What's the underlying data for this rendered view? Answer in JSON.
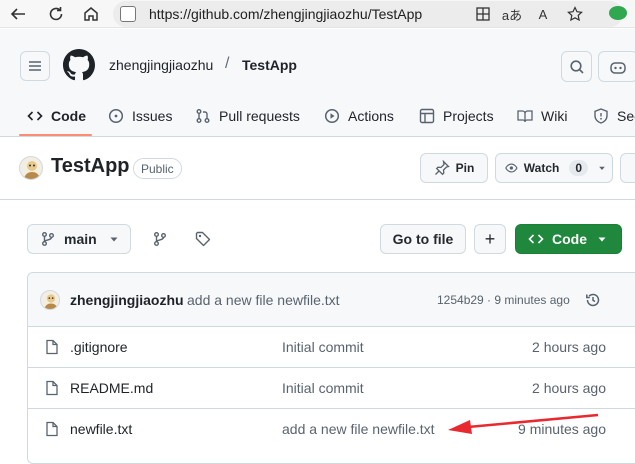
{
  "browser": {
    "url": "https://github.com/zhengjingjiaozhu/TestApp",
    "read_aloud_label": "aあ",
    "text_size_label": "A"
  },
  "header": {
    "owner": "zhengjingjiaozhu",
    "separator": "/",
    "repo": "TestApp"
  },
  "tabs": [
    {
      "label": "Code",
      "icon": "code-icon",
      "active": true
    },
    {
      "label": "Issues",
      "icon": "issue-opened-icon"
    },
    {
      "label": "Pull requests",
      "icon": "git-pull-request-icon"
    },
    {
      "label": "Actions",
      "icon": "play-icon"
    },
    {
      "label": "Projects",
      "icon": "table-icon"
    },
    {
      "label": "Wiki",
      "icon": "book-icon"
    },
    {
      "label": "Sec",
      "icon": "shield-icon"
    }
  ],
  "repo": {
    "name": "TestApp",
    "visibility": "Public",
    "pin_label": "Pin",
    "watch_label": "Watch",
    "watch_count": "0"
  },
  "toolbar": {
    "branch": "main",
    "goto_label": "Go to file",
    "plus_label": "+",
    "code_label": "Code"
  },
  "latest_commit": {
    "author": "zhengjingjiaozhu",
    "message": "add a new file newfile.txt",
    "meta": "1254b29 · 9 minutes ago"
  },
  "files": [
    {
      "name": ".gitignore",
      "commit": "Initial commit",
      "age": "2 hours ago"
    },
    {
      "name": "README.md",
      "commit": "Initial commit",
      "age": "2 hours ago"
    },
    {
      "name": "newfile.txt",
      "commit": "add a new file newfile.txt",
      "age": "9 minutes ago"
    }
  ],
  "colors": {
    "accent_tab": "#fd8c73",
    "code_button": "#1f883d",
    "annotation_arrow": "#e8292f"
  }
}
